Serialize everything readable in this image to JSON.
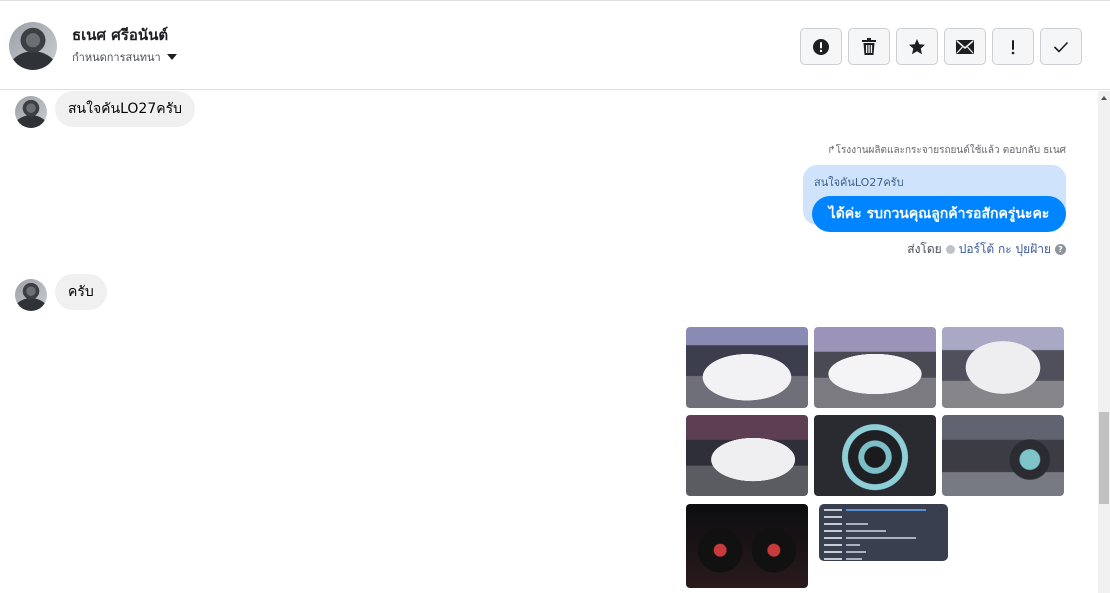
{
  "header": {
    "name": "ธเนศ ศรีอนันต์",
    "assign_label": "กำหนดการสนทนา",
    "actions": [
      {
        "name": "mark-spam-button",
        "icon": "alert-circle-icon"
      },
      {
        "name": "delete-button",
        "icon": "trash-icon"
      },
      {
        "name": "star-button",
        "icon": "star-icon"
      },
      {
        "name": "mark-unread-button",
        "icon": "envelope-icon"
      },
      {
        "name": "follow-up-button",
        "icon": "exclamation-icon"
      },
      {
        "name": "mark-done-button",
        "icon": "check-icon"
      }
    ]
  },
  "messages": {
    "incoming_1": "สนใจคันLO27ครับ",
    "reply_meta": "↱โรงงานผลิตและกระจายรถยนต์ใช้แล้ว ตอบกลับ ธเนศ",
    "quoted_text": "สนใจคันLO27ครับ",
    "outgoing_1": "ได้ค่ะ รบกวนคุณลูกค้ารอสักครู่นะคะ",
    "sent_by_prefix": "ส่งโดย",
    "sent_by_agent": "ปอร์โต้ กะ ปุยฝ้าย",
    "help_glyph": "?",
    "incoming_2": "ครับ"
  },
  "attachments": {
    "photos": [
      {
        "name": "truck-front-photo"
      },
      {
        "name": "truck-side-photo"
      },
      {
        "name": "truck-rear-photo"
      },
      {
        "name": "truck-angle-photo"
      },
      {
        "name": "steering-wheel-photo"
      },
      {
        "name": "cabin-photo"
      },
      {
        "name": "gauges-photo"
      },
      {
        "name": "vehicle-info-card"
      }
    ]
  }
}
